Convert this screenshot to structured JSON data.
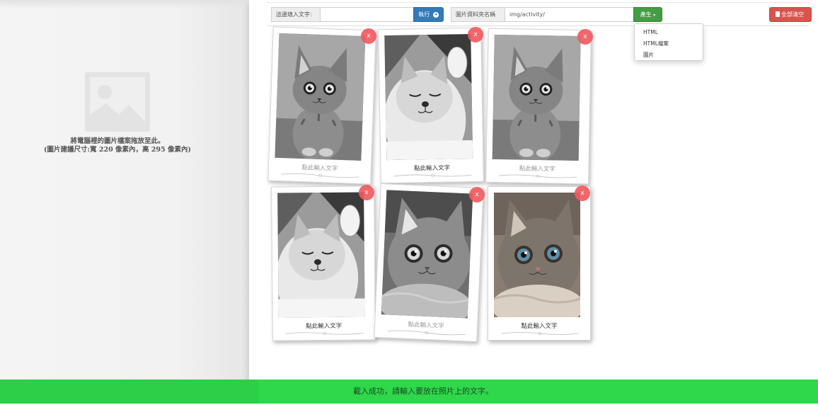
{
  "left_panel": {
    "placeholder_icon": "image-placeholder-icon",
    "hint_line1": "將電腦裡的圖片檔案拖放至此。",
    "hint_line2": "(圖片建議尺寸:寬 220 像素內，高 295 像素內)"
  },
  "toolbar": {
    "text_label": "這邊填入文字:",
    "text_value": "",
    "run_label": "執行",
    "run_icon": "arrow-circle-right-icon",
    "folder_label": "圖片資料夾名稱",
    "folder_value": "img/activity/",
    "generate_label": "產生",
    "clear_label": "全部清空",
    "clear_icon": "trash-icon"
  },
  "generate_menu": {
    "items": [
      "HTML",
      "HTML檔案",
      "圖片"
    ]
  },
  "cards": [
    {
      "caption": "點此輸入文字",
      "caption_dim": true,
      "delete": "x",
      "cat": "bw-sitting"
    },
    {
      "caption": "點此輸入文字",
      "caption_dim": false,
      "delete": "x",
      "cat": "bw-sleeping"
    },
    {
      "caption": "點此輸入文字",
      "caption_dim": true,
      "delete": "x",
      "cat": "bw-sitting"
    },
    {
      "caption": "點此輸入文字",
      "caption_dim": false,
      "delete": "x",
      "cat": "bw-sleeping"
    },
    {
      "caption": "點此輸入文字",
      "caption_dim": true,
      "delete": "x",
      "cat": "bw-closeup"
    },
    {
      "caption": "點此輸入文字",
      "caption_dim": false,
      "delete": "x",
      "cat": "color-closeup"
    }
  ],
  "status": {
    "message": "載入成功，請輸入要放在照片上的文字。"
  },
  "colors": {
    "status_bar": "#2ed84a",
    "run_button": "#337ab7",
    "generate_button": "#449d44",
    "clear_button": "#d9534f",
    "delete_badge": "#f05a5f"
  }
}
